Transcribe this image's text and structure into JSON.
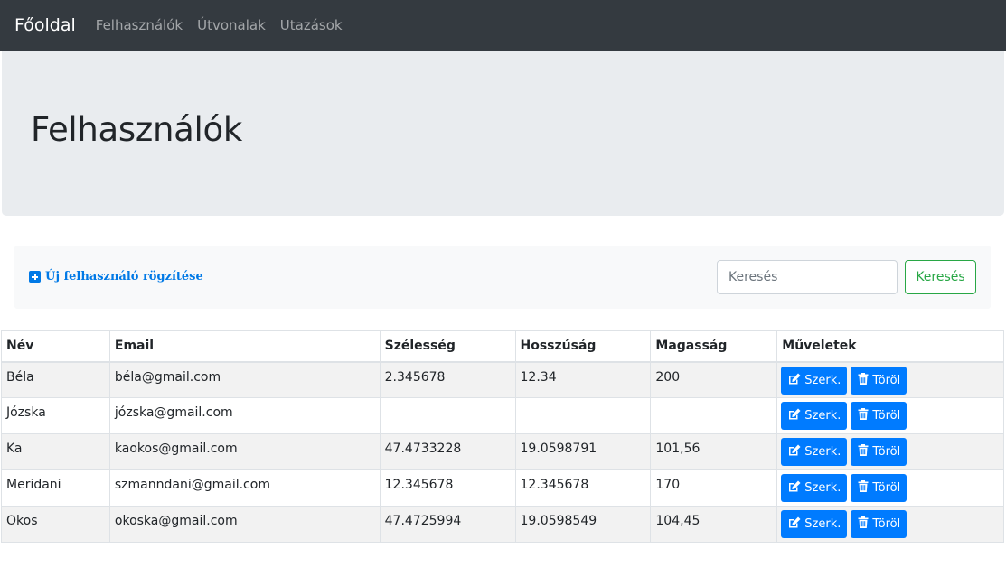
{
  "navbar": {
    "brand": "Főoldal",
    "links": [
      "Felhasználók",
      "Útvonalak",
      "Utazások"
    ]
  },
  "jumbotron": {
    "title": "Felhasználók"
  },
  "toolbar": {
    "new_user_label": "Új felhasználó rögzítése",
    "search_placeholder": "Keresés",
    "search_button": "Keresés"
  },
  "table": {
    "headers": [
      "Név",
      "Email",
      "Szélesség",
      "Hosszúság",
      "Magasság",
      "Műveletek"
    ],
    "edit_label": "Szerk.",
    "delete_label": "Töröl",
    "rows": [
      [
        "Béla",
        "béla@gmail.com",
        "2.345678",
        "12.34",
        "200"
      ],
      [
        "Józska",
        "józska@gmail.com",
        "",
        "",
        ""
      ],
      [
        "Ka",
        "kaokos@gmail.com",
        "47.4733228",
        "19.0598791",
        "101,56"
      ],
      [
        "Meridani",
        "szmanndani@gmail.com",
        "12.345678",
        "12.345678",
        "170"
      ],
      [
        "Okos",
        "okoska@gmail.com",
        "47.4725994",
        "19.0598549",
        "104,45"
      ]
    ]
  },
  "colors": {
    "navbar": "#343a40",
    "jumbotron": "#e9ecef",
    "primary": "#007bff",
    "success": "#28a745"
  }
}
